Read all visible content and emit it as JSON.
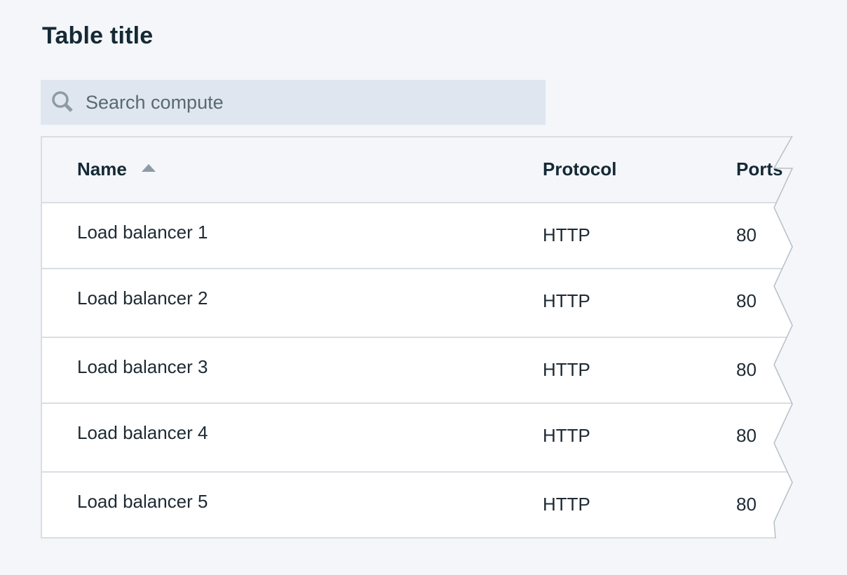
{
  "title": "Table title",
  "search": {
    "placeholder": "Search compute",
    "value": ""
  },
  "table": {
    "columns": [
      {
        "label": "Name",
        "sort": "ascending"
      },
      {
        "label": "Protocol"
      },
      {
        "label": "Ports"
      }
    ],
    "rows": [
      {
        "name": "Load balancer 1",
        "protocol": "HTTP",
        "ports": "80"
      },
      {
        "name": "Load balancer 2",
        "protocol": "HTTP",
        "ports": "80"
      },
      {
        "name": "Load balancer 3",
        "protocol": "HTTP",
        "ports": "80"
      },
      {
        "name": "Load balancer 4",
        "protocol": "HTTP",
        "ports": "80"
      },
      {
        "name": "Load balancer 5",
        "protocol": "HTTP",
        "ports": "80"
      }
    ]
  },
  "icons": {
    "search": "search-icon",
    "sort": "sort-ascending-icon"
  },
  "colors": {
    "background": "#f4f6f9",
    "search_background": "#dfe6ef",
    "row_background": "#ffffff",
    "border": "#d8dee4",
    "text": "#152935",
    "muted": "#8c9ba5"
  }
}
